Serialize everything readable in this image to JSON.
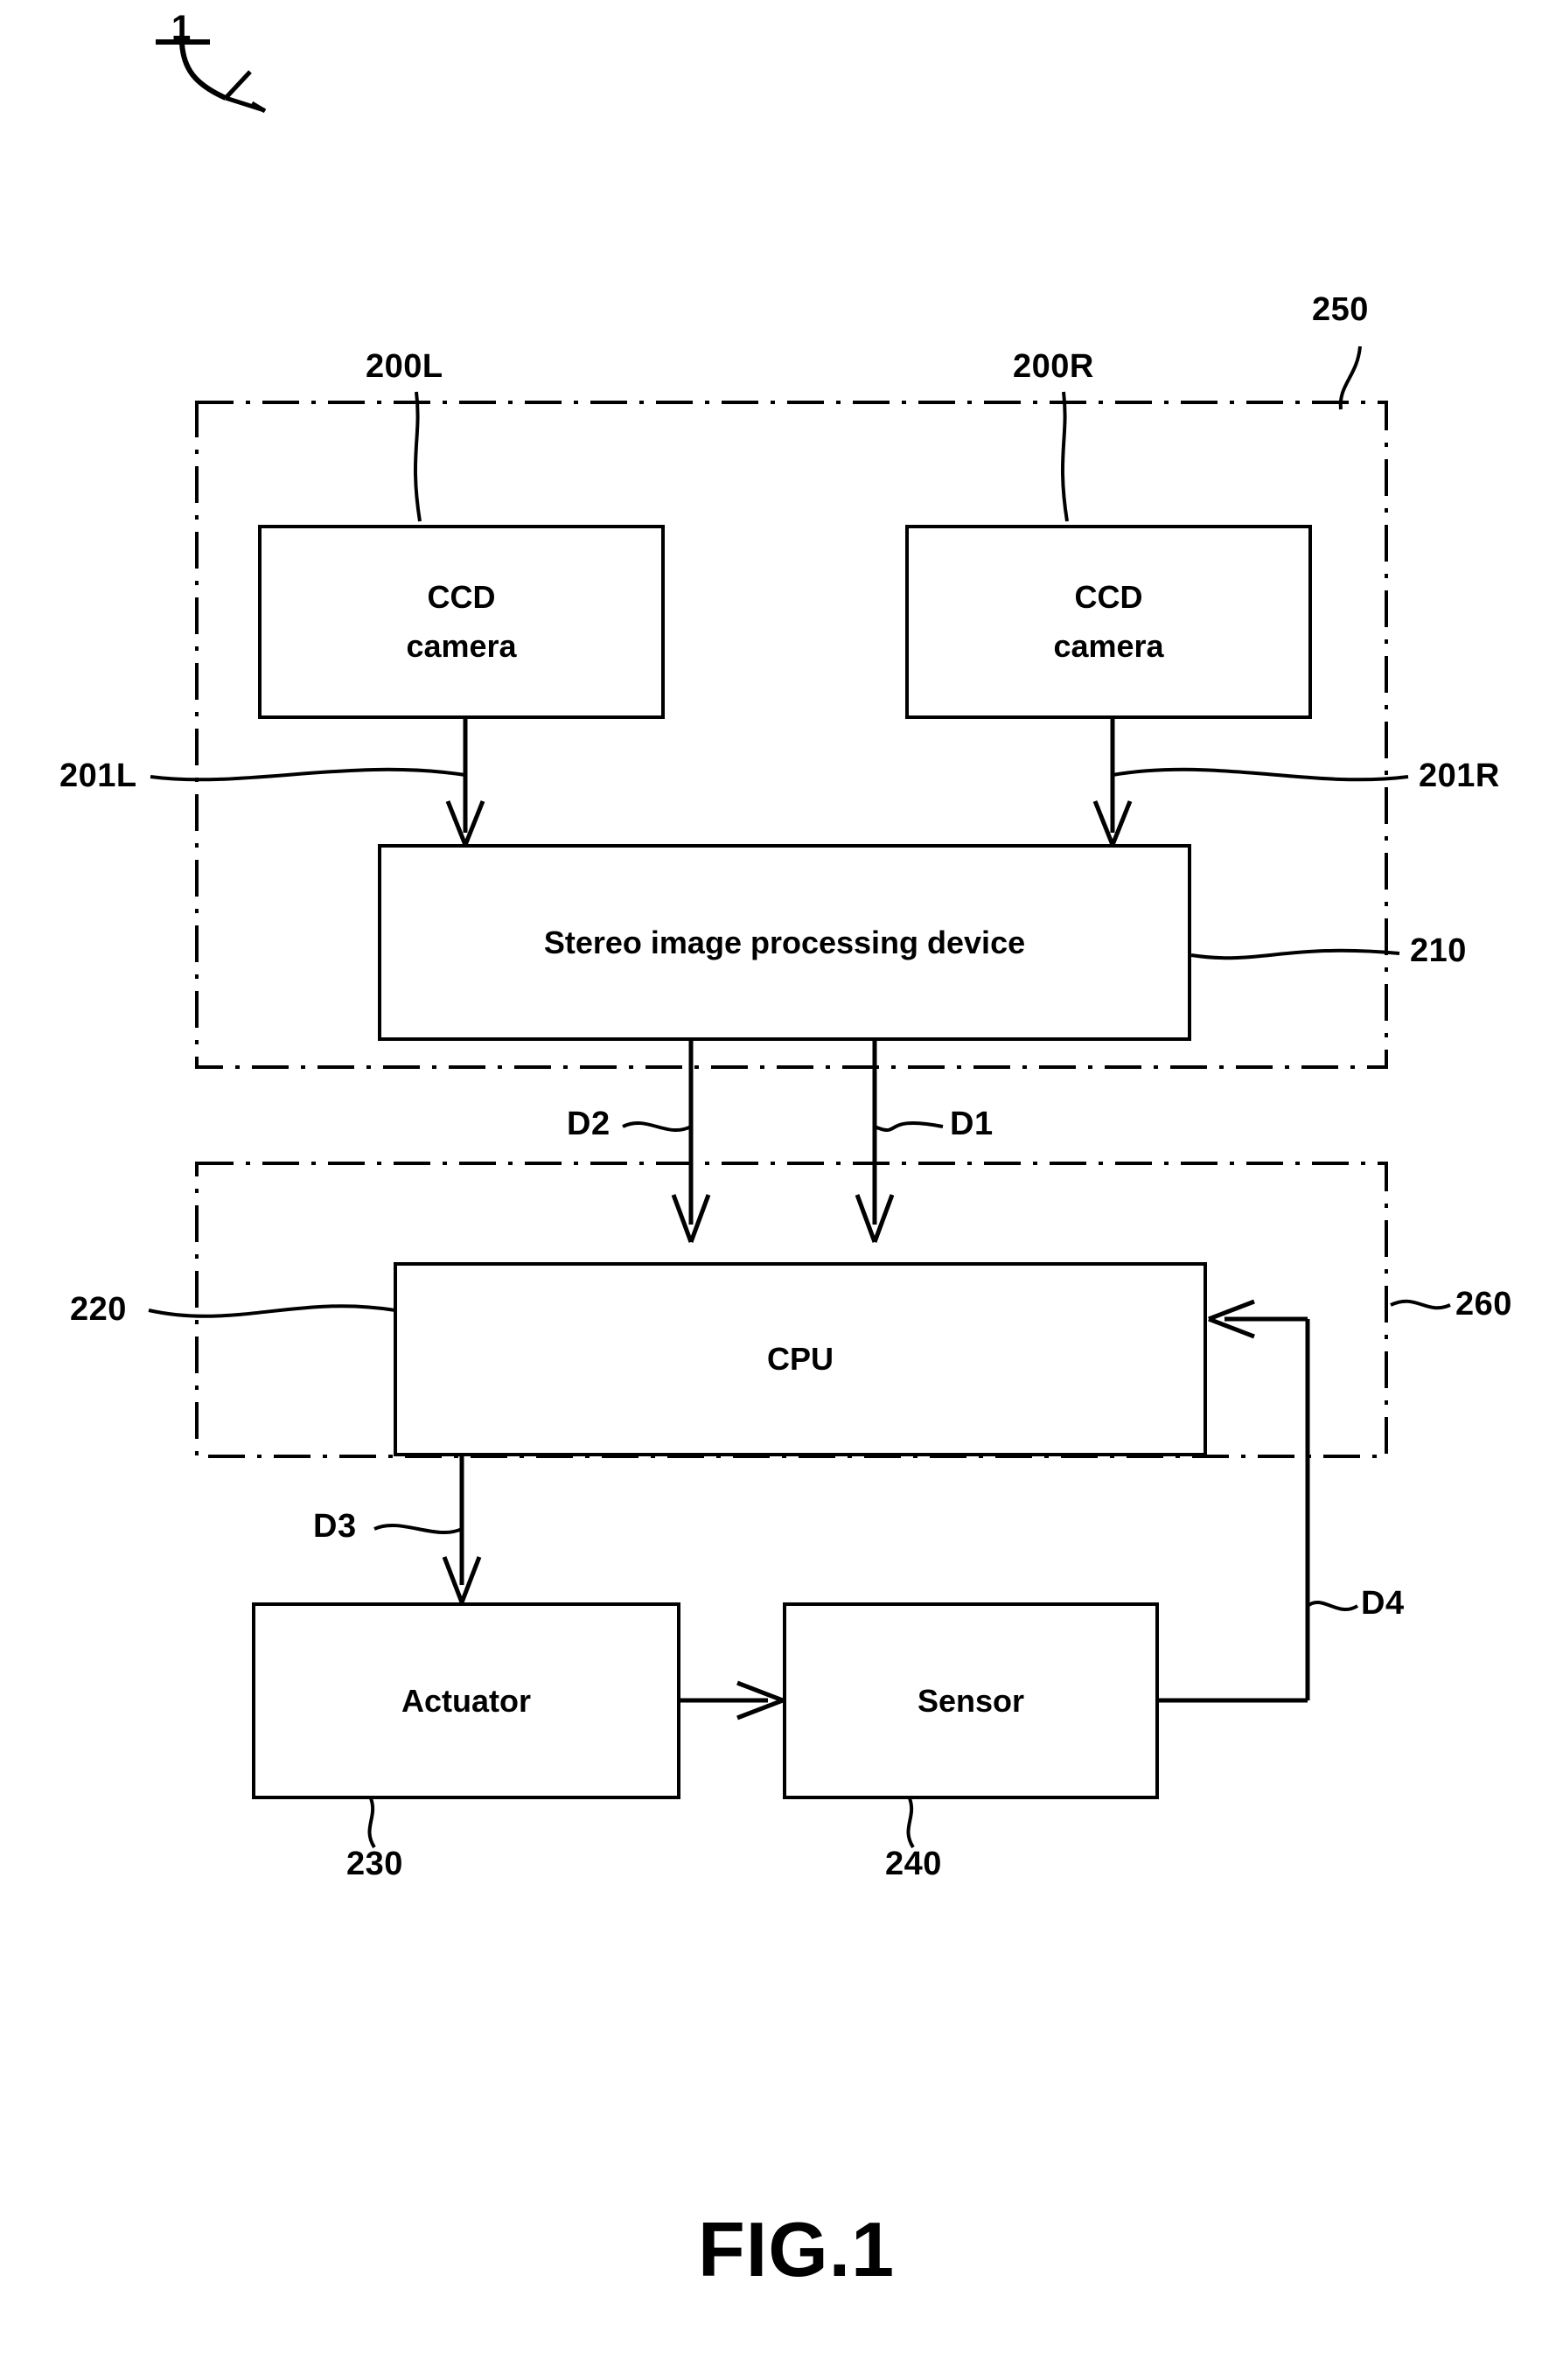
{
  "figure": {
    "caption": "FIG.1",
    "system_number": "1"
  },
  "blocks": [
    {
      "id": "ccd-left",
      "label_line1": "CCD",
      "label_line2": "camera",
      "ref": "200L"
    },
    {
      "id": "ccd-right",
      "label_line1": "CCD",
      "label_line2": "camera",
      "ref": "200R"
    },
    {
      "id": "stereo",
      "label_line1": "Stereo image processing device",
      "label_line2": "",
      "ref": "210"
    },
    {
      "id": "cpu",
      "label_line1": "CPU",
      "label_line2": "",
      "ref": "220"
    },
    {
      "id": "actuator",
      "label_line1": "Actuator",
      "label_line2": "",
      "ref": "230"
    },
    {
      "id": "sensor",
      "label_line1": "Sensor",
      "label_line2": "",
      "ref": "240"
    }
  ],
  "group_refs": {
    "upper_unit": "250",
    "lower_unit": "260"
  },
  "signal_labels": {
    "left_image": "201L",
    "right_image": "201R",
    "d1": "D1",
    "d2": "D2",
    "d3": "D3",
    "d4": "D4"
  },
  "colors": {
    "line": "#000000",
    "background": "#ffffff"
  }
}
